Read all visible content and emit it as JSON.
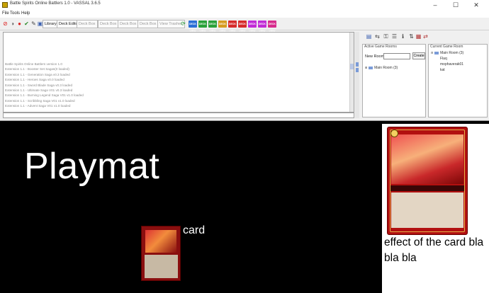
{
  "window": {
    "title": "Battle Spirits Online Battlers 1.0 - VASSAL 3.6.5",
    "controls": {
      "minimize": "–",
      "maximize": "☐",
      "close": "✕"
    }
  },
  "menu": {
    "items": [
      "File",
      "Tools",
      "Help"
    ]
  },
  "toolbar": {
    "library": "Library",
    "deck_editor": "Deck Editor",
    "deck_box": "Deck Box",
    "deck_box_2": "Deck Box",
    "deck_box_3": "Deck Box",
    "deck_box_4": "Deck Box",
    "view_trashes": "View Trashes",
    "deck_tags": [
      {
        "label": "DECK VIEW",
        "color": "#2b6fd6"
      },
      {
        "label": "DECK VIEW",
        "color": "#2aa13a"
      },
      {
        "label": "DECK VIEW",
        "color": "#2aa13a"
      },
      {
        "label": "DECK VIEW",
        "color": "#d69b1f"
      },
      {
        "label": "DECK VIEW",
        "color": "#d62b2b"
      },
      {
        "label": "DECK VIEW",
        "color": "#d62b2b"
      },
      {
        "label": "DECK VIEW",
        "color": "#c02bd6"
      },
      {
        "label": "DECK VIEW",
        "color": "#c02bd6"
      },
      {
        "label": "DECK VIEW",
        "color": "#d62b8c"
      }
    ]
  },
  "log": {
    "lines": [
      "Battle Spirits Online Battlers version 1.0",
      "Extension 1.1 - Booster Set Sagas(0 loaded)",
      "Extension 1.1 - Generation Saga v0.3 loaded",
      "Extension 1.1 - Heroes Saga v0.0 loaded",
      "Extension 1.1 - Sword Blade Saga v0.3 loaded",
      "Extension 1.1 - Ultimate Saga V01 v0.3 loaded",
      "Extension 1.1 - Burning Legend Saga V01 v1.0 loaded",
      "Extension 1.1 - Scribbling Saga V01 v1.0 loaded",
      "Extension 1.1 - Advent Saga V01 v1.0 loaded"
    ]
  },
  "rooms": {
    "title": "Active Game Rooms",
    "new_room_label": "New Room:",
    "new_room_value": "",
    "create_button": "Create",
    "tree": [
      {
        "label": "Main Room (3)"
      }
    ]
  },
  "users": {
    "title": "Current Game Room",
    "room": "Main Room (3)",
    "players": [
      "Flaq",
      "mophaverak01",
      "kat"
    ]
  },
  "playmat": {
    "title": "Playmat",
    "card_label": "card",
    "effect_text": "effect of the card bla bla bla"
  }
}
